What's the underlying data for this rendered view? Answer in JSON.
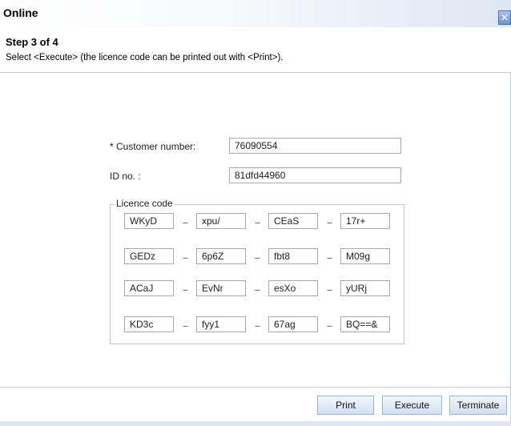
{
  "window": {
    "title": "Online",
    "close_glyph": "✕"
  },
  "step": {
    "title": "Step 3 of 4",
    "description": "Select <Execute> (the licence code can be printed out with <Print>)."
  },
  "form": {
    "customer_label": "* Customer number:",
    "customer_value": "76090554",
    "id_label": "ID no. :",
    "id_value": "81dfd44960"
  },
  "licence": {
    "legend": "Licence code",
    "separator": "---",
    "rows": [
      [
        "WKyD",
        "xpu/",
        "CEaS",
        "17r+"
      ],
      [
        "GEDz",
        "6p6Z",
        "fbt8",
        "M09g"
      ],
      [
        "ACaJ",
        "EvNr",
        "esXo",
        "yURj"
      ],
      [
        "KD3c",
        "fyy1",
        "67ag",
        "BQ==&"
      ]
    ]
  },
  "buttons": {
    "print": "Print",
    "execute": "Execute",
    "terminate": "Terminate"
  }
}
